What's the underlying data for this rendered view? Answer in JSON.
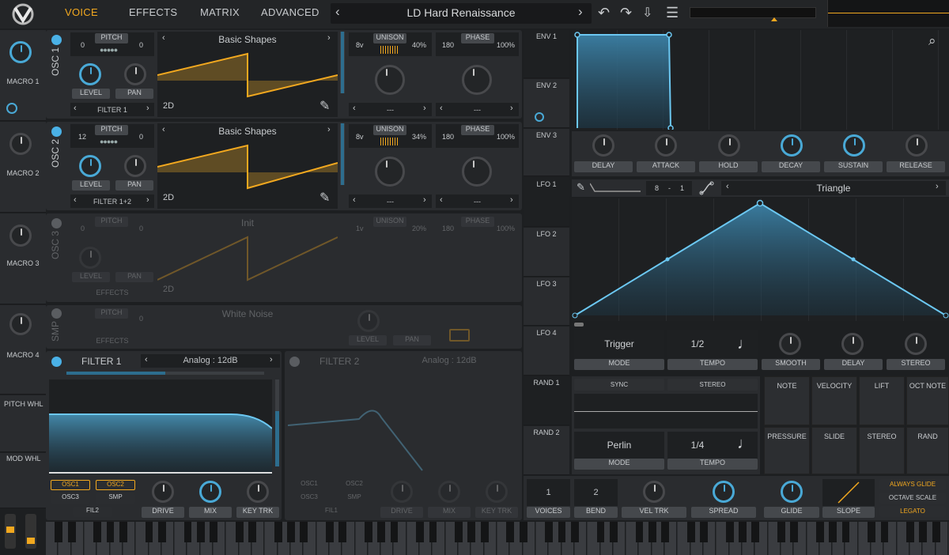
{
  "nav": {
    "tabs": [
      "VOICE",
      "EFFECTS",
      "MATRIX",
      "ADVANCED"
    ],
    "active": "VOICE"
  },
  "preset": {
    "name": "LD Hard Renaissance",
    "prev": "‹",
    "next": "›"
  },
  "colors": {
    "accent": "#f2a81f",
    "blue": "#4ab1e6",
    "panel": "#2a2c2f",
    "bg": "#1d1f21"
  },
  "macros": [
    "MACRO 1",
    "MACRO 2",
    "MACRO 3",
    "MACRO 4"
  ],
  "wheels": [
    "PITCH WHL",
    "MOD WHL"
  ],
  "osc": [
    {
      "label": "OSC 1",
      "pitch_btn": "PITCH",
      "pitch_left": "0",
      "pitch_right": "0",
      "wave": "Basic Shapes",
      "mode": "2D",
      "unison": "UNISON",
      "uni_voices": "8v",
      "uni_pct": "40%",
      "phase": "PHASE",
      "phase_val": "180",
      "phase_pct": "100%",
      "level": "LEVEL",
      "pan": "PAN",
      "filter": "FILTER 1",
      "dash1": "---",
      "dash2": "---"
    },
    {
      "label": "OSC 2",
      "pitch_btn": "PITCH",
      "pitch_left": "12",
      "pitch_right": "0",
      "wave": "Basic Shapes",
      "mode": "2D",
      "unison": "UNISON",
      "uni_voices": "8v",
      "uni_pct": "34%",
      "phase": "PHASE",
      "phase_val": "180",
      "phase_pct": "100%",
      "level": "LEVEL",
      "pan": "PAN",
      "filter": "FILTER 1+2",
      "dash1": "---",
      "dash2": "---"
    },
    {
      "label": "OSC 3",
      "pitch_btn": "PITCH",
      "pitch_left": "0",
      "pitch_right": "0",
      "wave": "Init",
      "mode": "2D",
      "unison": "UNISON",
      "uni_voices": "1v",
      "uni_pct": "20%",
      "phase": "PHASE",
      "phase_val": "180",
      "phase_pct": "100%",
      "level": "LEVEL",
      "pan": "PAN",
      "filter": "EFFECTS"
    }
  ],
  "smp": {
    "label": "SMP",
    "pitch_btn": "PITCH",
    "pitch_val": "0",
    "sample": "White Noise",
    "level": "LEVEL",
    "pan": "PAN",
    "route": "EFFECTS"
  },
  "filter1": {
    "title": "FILTER 1",
    "type": "Analog : 12dB",
    "routes": [
      "OSC1",
      "OSC2",
      "OSC3",
      "SMP",
      "FIL2"
    ],
    "knobs": [
      "DRIVE",
      "MIX",
      "KEY TRK"
    ]
  },
  "filter2": {
    "title": "FILTER 2",
    "type": "Analog : 12dB",
    "routes": [
      "OSC1",
      "OSC2",
      "OSC3",
      "SMP",
      "FIL1"
    ],
    "knobs": [
      "DRIVE",
      "MIX",
      "KEY TRK"
    ]
  },
  "env": {
    "labels": [
      "ENV 1",
      "ENV 2",
      "ENV 3"
    ],
    "knobs": [
      "DELAY",
      "ATTACK",
      "HOLD",
      "DECAY",
      "SUSTAIN",
      "RELEASE"
    ]
  },
  "lfo": {
    "labels": [
      "LFO 1",
      "LFO 2",
      "LFO 3",
      "LFO 4"
    ],
    "grid_a": "8",
    "grid_sep": "-",
    "grid_b": "1",
    "shape": "Triangle",
    "mode_val": "Trigger",
    "mode": "MODE",
    "tempo_val": "1/2",
    "tempo": "TEMPO",
    "knobs": [
      "SMOOTH",
      "DELAY",
      "STEREO"
    ]
  },
  "rand": {
    "labels": [
      "RAND 1",
      "RAND 2"
    ],
    "sync": "SYNC",
    "stereo": "STEREO",
    "mode_val": "Perlin",
    "mode": "MODE",
    "tempo_val": "1/4",
    "tempo": "TEMPO"
  },
  "sources": [
    "NOTE",
    "VELOCITY",
    "LIFT",
    "OCT NOTE",
    "PRESSURE",
    "SLIDE",
    "STEREO",
    "RAND"
  ],
  "voice": {
    "voices_val": "1",
    "voices": "VOICES",
    "bend_val": "2",
    "bend": "BEND",
    "vel": "VEL TRK",
    "spread": "SPREAD",
    "glide": "GLIDE",
    "slope": "SLOPE",
    "always": "ALWAYS GLIDE",
    "octave": "OCTAVE SCALE",
    "legato": "LEGATO"
  }
}
